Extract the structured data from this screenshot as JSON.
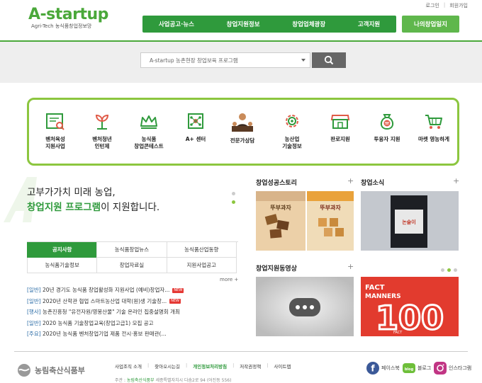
{
  "header": {
    "top_links": [
      "로그인",
      "회원가입"
    ],
    "logo_text": "A-startup",
    "logo_subtitle": "Agri-Tech 농식품창업정보망",
    "nav": [
      "사업공고·뉴스",
      "창업지원정보",
      "창업업체광장",
      "고객지원"
    ],
    "my_button": "나의창업일지"
  },
  "search": {
    "select_value": "A-startup 농촌현장 창업보육 프로그램",
    "button_icon": "search-icon"
  },
  "categories": [
    {
      "label": "벤처육성\n지원사업",
      "icon": "report-icon"
    },
    {
      "label": "벤처청년\n인턴제",
      "icon": "sprout-icon"
    },
    {
      "label": "농식품\n창업콘테스트",
      "icon": "crown-icon"
    },
    {
      "label": "A+ 센터",
      "icon": "network-icon"
    },
    {
      "label": "전문가상담",
      "icon": "consultant-icon"
    },
    {
      "label": "농산업\n기술정보",
      "icon": "gear-icon"
    },
    {
      "label": "판로지원",
      "icon": "store-icon"
    },
    {
      "label": "투융자 지원",
      "icon": "money-bag-icon"
    },
    {
      "label": "마켓 영농하게",
      "icon": "cart-icon"
    }
  ],
  "tagline": {
    "line1": "고부가가치 미래 농업,",
    "line2_highlight": "창업지원 프로그램",
    "line2_rest": "이 지원합니다."
  },
  "tabs": {
    "row1": [
      "공지사항",
      "농식품창업뉴스",
      "농식품산업동향"
    ],
    "row2": [
      "농식품기술정보",
      "창업자료실",
      "지원사업공고"
    ],
    "active": "공지사항",
    "more": "more +"
  },
  "news": [
    {
      "cat": "[일반]",
      "title": " 20년 경기도 농식품 창업활성화 지원사업 (예비)창업자...",
      "new": "NEW"
    },
    {
      "cat": "[일반]",
      "title": " 2020년 산학관 협업 스마트농산업 대학(원)생 기술창...",
      "new": "NEW"
    },
    {
      "cat": "[행사]",
      "title": " 농촌진흥청 \"유전자원/영봉산물\" 기술 온라인 집중설명회 개최",
      "new": ""
    },
    {
      "cat": "[일반]",
      "title": " 2020 농식품 기술창업교육(창업고급1) 모집 공고",
      "new": ""
    },
    {
      "cat": "[주요]",
      "title": " 2020년 농식품 벤처창업기업 제품 전시·홍보 판매관(...",
      "new": ""
    }
  ],
  "panels": {
    "success_story": "창업성공스토리",
    "news": "창업소식",
    "video": "창업지원동영상",
    "plus": "+",
    "product_label": "뚜부과자",
    "news_product_label": "논술이",
    "banner_text1": "FACT",
    "banner_text2": "MANNERS",
    "banner_number": "100",
    "banner_sub": "FACT"
  },
  "footer": {
    "org": "농림축산식품부",
    "links": [
      "사업조직 소개",
      "찾아오시는길",
      "개인정보처리방침",
      "저작권정책",
      "사이트맵"
    ],
    "address_label": "주관 : ",
    "address_org": "농림축산식품부",
    "address": " 세종특별자치시 다솜2로 94 (어진동 556)",
    "sns": [
      "페이스북",
      "블로그",
      "인스타그램"
    ]
  },
  "colors": {
    "brand_green": "#2f9a3c",
    "light_green": "#8cc63f",
    "banner_red": "#e23b2e"
  }
}
